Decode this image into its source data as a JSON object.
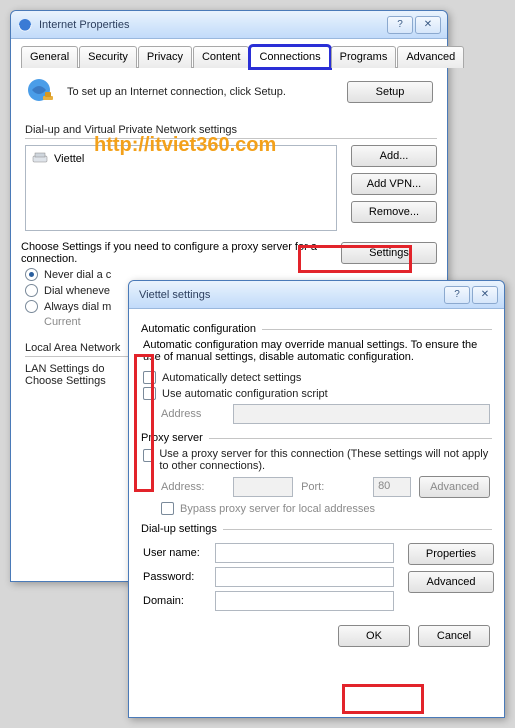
{
  "watermark": "http://itviet360.com",
  "win1": {
    "title": "Internet Properties",
    "help_glyph": "?",
    "close_glyph": "✕",
    "tabs": [
      "General",
      "Security",
      "Privacy",
      "Content",
      "Connections",
      "Programs",
      "Advanced"
    ],
    "active_tab_index": 4,
    "setup_text": "To set up an Internet connection, click Setup.",
    "setup_btn": "Setup",
    "dialup_label": "Dial-up and Virtual Private Network settings",
    "list_item": "Viettel",
    "add_btn": "Add...",
    "addvpn_btn": "Add VPN...",
    "remove_btn": "Remove...",
    "choose_text": "Choose Settings if you need to configure a proxy server for a connection.",
    "settings_btn": "Settings",
    "radio_never": "Never dial a c",
    "radio_when": "Dial wheneve",
    "radio_always": "Always dial m",
    "current_label": "Current",
    "lan_label": "Local Area Network",
    "lan_text": "LAN Settings do\nChoose Settings"
  },
  "win2": {
    "title": "Viettel settings",
    "help_glyph": "?",
    "close_glyph": "✕",
    "auto_label": "Automatic configuration",
    "auto_text": "Automatic configuration may override manual settings.  To ensure the use of manual settings, disable automatic configuration.",
    "chk_auto_detect": "Automatically detect settings",
    "chk_auto_script": "Use automatic configuration script",
    "addr_label": "Address",
    "proxy_label": "Proxy server",
    "chk_proxy": "Use a proxy server for this connection (These settings will not apply to other connections).",
    "proxy_addr_label": "Address:",
    "proxy_port_label": "Port:",
    "proxy_port_value": "80",
    "advanced_btn": "Advanced",
    "chk_bypass": "Bypass proxy server for local addresses",
    "dialup_label": "Dial-up settings",
    "user_label": "User name:",
    "pass_label": "Password:",
    "domain_label": "Domain:",
    "props_btn": "Properties",
    "adv2_btn": "Advanced",
    "ok_btn": "OK",
    "cancel_btn": "Cancel"
  }
}
